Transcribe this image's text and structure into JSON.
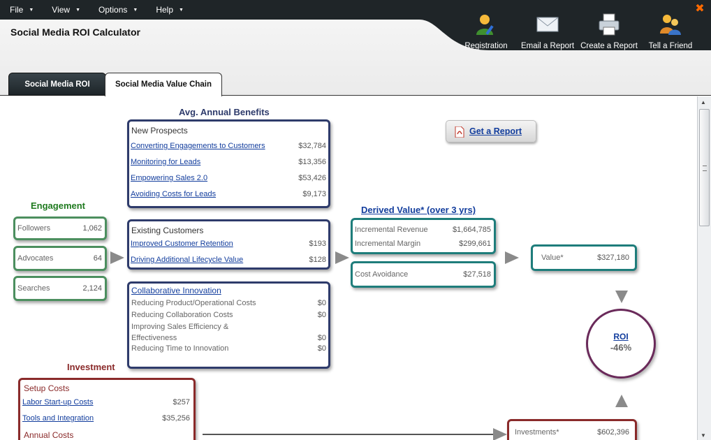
{
  "menu": {
    "items": [
      {
        "label": "File"
      },
      {
        "label": "View"
      },
      {
        "label": "Options"
      },
      {
        "label": "Help"
      }
    ]
  },
  "app": {
    "title": "Social Media ROI Calculator"
  },
  "toolbar": {
    "registration": "Registration",
    "email_report": "Email a Report",
    "create_report": "Create a Report",
    "tell_friend": "Tell a Friend"
  },
  "tabs": {
    "roi": "Social Media ROI",
    "value_chain": "Social Media Value Chain"
  },
  "benefits": {
    "heading": "Avg. Annual Benefits",
    "new_prospects": {
      "title": "New Prospects",
      "rows": [
        {
          "label": "Converting Engagements to Customers",
          "value": "$32,784"
        },
        {
          "label": "Monitoring for Leads",
          "value": "$13,356"
        },
        {
          "label": "Empowering Sales 2.0",
          "value": "$53,426"
        },
        {
          "label": "Avoiding Costs for Leads",
          "value": "$9,173"
        }
      ]
    },
    "existing_customers": {
      "title": "Existing Customers",
      "rows": [
        {
          "label": "Improved Customer Retention",
          "value": "$193"
        },
        {
          "label": "Driving Additional Lifecycle Value",
          "value": "$128"
        }
      ]
    },
    "collaborative_innovation": {
      "title": "Collaborative Innovation",
      "rows": [
        {
          "label": "Reducing Product/Operational Costs",
          "value": "$0"
        },
        {
          "label": "Reducing Collaboration Costs",
          "value": "$0"
        },
        {
          "label": "Improving Sales Efficiency &",
          "label2": "Effectiveness",
          "value": "$0"
        },
        {
          "label": "Reducing Time to Innovation",
          "value": "$0"
        }
      ]
    }
  },
  "engagement": {
    "heading": "Engagement",
    "items": [
      {
        "label": "Followers",
        "value": "1,062"
      },
      {
        "label": "Advocates",
        "value": "64"
      },
      {
        "label": "Searches",
        "value": "2,124"
      }
    ]
  },
  "derived": {
    "heading": "Derived Value* (over 3 yrs)",
    "revenue": {
      "label": "Incremental Revenue",
      "value": "$1,664,785"
    },
    "margin": {
      "label": "Incremental Margin",
      "value": "$299,661"
    },
    "cost_avoidance": {
      "label": "Cost Avoidance",
      "value": "$27,518"
    }
  },
  "value_box": {
    "label": "Value*",
    "value": "$327,180"
  },
  "roi": {
    "label": "ROI",
    "value": "-46%"
  },
  "get_report": "Get a Report",
  "investment": {
    "heading": "Investment",
    "setup_title": "Setup Costs",
    "rows": [
      {
        "label": "Labor Start-up Costs",
        "value": "$257"
      },
      {
        "label": "Tools and Integration",
        "value": "$35,256"
      }
    ],
    "annual_title": "Annual Costs"
  },
  "investments_box": {
    "label": "Investments*",
    "value": "$602,396"
  },
  "colors": {
    "menubar": "#1f2528",
    "blue_border": "#2e3b6b",
    "green_border": "#4c8f5f",
    "teal_border": "#1e7d7b",
    "red_border": "#8a2a2a",
    "roi_border": "#6a2a5a",
    "link": "#123d9d"
  }
}
